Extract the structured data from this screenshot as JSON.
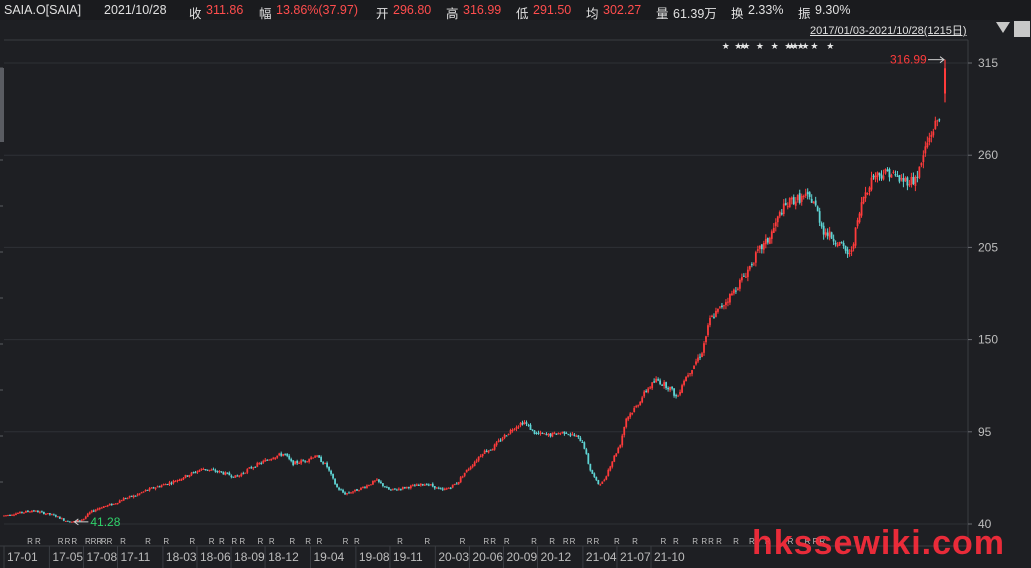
{
  "header": {
    "symbol": "SAIA.O[SAIA]",
    "date": "2021/10/28",
    "close_label": "收",
    "close_value": "311.86",
    "change_label": "幅",
    "change_value": "13.86%(37.97)",
    "open_label": "开",
    "open_value": "296.80",
    "high_label": "高",
    "high_value": "316.99",
    "low_label": "低",
    "low_value": "291.50",
    "avg_label": "均",
    "avg_value": "302.27",
    "volume_label": "量",
    "volume_value": "61.39万",
    "turnover_label": "换",
    "turnover_value": "2.33%",
    "amplitude_label": "振",
    "amplitude_value": "9.30%"
  },
  "range_label": "2017/01/03-2021/10/28(1215日)",
  "watermark": "hkssewiki.com",
  "colors": {
    "up": "#ff3b3b",
    "down": "#5fd4d4",
    "axis_text": "#bdbdbd",
    "grid": "#2e3036",
    "max_label": "#ff3b3b",
    "min_label": "#2fd26a",
    "background": "#1e1f23"
  },
  "chart_data": {
    "type": "candlestick",
    "y_ticks": [
      40,
      95,
      150,
      205,
      260,
      315
    ],
    "ylim": [
      36,
      322
    ],
    "x_ticks": [
      "17-01",
      "17-05",
      "17-08",
      "17-11",
      "18-03",
      "18-06",
      "18-09",
      "18-12",
      "19-04",
      "19-08",
      "19-11",
      "20-03",
      "20-06",
      "20-09",
      "20-12",
      "21-04",
      "21-07",
      "21-10"
    ],
    "max_marker": {
      "value": 316.99,
      "label": "316.99"
    },
    "min_marker": {
      "value": 41.28,
      "label": "41.28"
    },
    "series_path": [
      [
        0,
        45
      ],
      [
        2.5,
        48
      ],
      [
        4.5,
        45
      ],
      [
        5.4,
        42
      ],
      [
        6.2,
        41.3
      ],
      [
        7.0,
        43
      ],
      [
        7.6,
        47
      ],
      [
        8.5,
        50
      ],
      [
        9.7,
        52
      ],
      [
        10.5,
        55
      ],
      [
        11.6,
        57
      ],
      [
        12.5,
        60
      ],
      [
        13.4,
        62
      ],
      [
        14.8,
        65
      ],
      [
        16.5,
        70
      ],
      [
        17.5,
        73
      ],
      [
        19,
        71
      ],
      [
        20.5,
        68
      ],
      [
        21.6,
        73
      ],
      [
        22.5,
        76
      ],
      [
        23.7,
        80
      ],
      [
        24.7,
        82
      ],
      [
        25.4,
        76
      ],
      [
        26.6,
        78
      ],
      [
        27.4,
        81
      ],
      [
        28.4,
        75
      ],
      [
        29.3,
        62
      ],
      [
        30,
        58
      ],
      [
        31,
        60
      ],
      [
        32,
        63
      ],
      [
        32.8,
        66
      ],
      [
        34,
        60
      ],
      [
        35.5,
        62
      ],
      [
        37.3,
        64
      ],
      [
        38.6,
        60
      ],
      [
        39.3,
        62
      ],
      [
        40,
        65
      ],
      [
        40.5,
        70
      ],
      [
        41.2,
        75
      ],
      [
        42.2,
        83
      ],
      [
        43,
        85
      ],
      [
        44,
        92
      ],
      [
        45,
        98
      ],
      [
        45.8,
        101
      ],
      [
        46.8,
        94
      ],
      [
        48,
        93
      ],
      [
        49.5,
        95
      ],
      [
        50.4,
        92
      ],
      [
        51,
        89
      ],
      [
        51.6,
        73
      ],
      [
        52.3,
        64
      ],
      [
        52.8,
        65
      ],
      [
        53.4,
        75
      ],
      [
        54.3,
        88
      ],
      [
        54.8,
        103
      ],
      [
        55.7,
        110
      ],
      [
        56.6,
        120
      ],
      [
        57.5,
        126
      ],
      [
        58.7,
        121
      ],
      [
        59.3,
        115
      ],
      [
        59.8,
        125
      ],
      [
        60.6,
        133
      ],
      [
        61.5,
        143
      ],
      [
        62.2,
        162
      ],
      [
        63,
        168
      ],
      [
        64.2,
        178
      ],
      [
        65.4,
        190
      ],
      [
        66.5,
        203
      ],
      [
        67.4,
        210
      ],
      [
        68.5,
        227
      ],
      [
        69.4,
        233
      ],
      [
        70.6,
        235
      ],
      [
        71.3,
        233
      ],
      [
        72.2,
        215
      ],
      [
        73.5,
        208
      ],
      [
        74.5,
        200
      ],
      [
        74.8,
        208
      ],
      [
        75.7,
        235
      ],
      [
        76.6,
        248
      ],
      [
        78,
        250
      ],
      [
        79,
        245
      ],
      [
        80.2,
        245
      ],
      [
        80.7,
        252
      ],
      [
        81.2,
        265
      ],
      [
        82,
        278
      ],
      [
        82.4,
        282
      ]
    ],
    "last_candle": {
      "open": 296.8,
      "high": 316.99,
      "low": 291.5,
      "close": 311.86
    },
    "event_markers": {
      "stars_positions_months": [
        63.5,
        64.6,
        65.0,
        65.3,
        66.5,
        67.8,
        69.0,
        69.3,
        69.6,
        70.1,
        70.5,
        71.3,
        72.7
      ],
      "bottom_R_months": [
        2.3,
        3.0,
        5.0,
        5.6,
        6.2,
        7.4,
        7.9,
        8.4,
        8.8,
        9.3,
        10.5,
        12.7,
        14.3,
        16.6,
        18.3,
        19.2,
        20.3,
        21.0,
        22.6,
        23.6,
        25.4,
        26.8,
        27.8,
        30.1,
        31.1,
        34.9,
        37.3,
        40.4,
        42.5,
        43.1,
        44.3,
        46.7,
        48.3,
        49.5,
        50.1,
        51.6,
        52.2,
        54.0,
        55.6,
        58.1,
        59.2,
        60.9,
        61.7,
        62.3,
        63.0,
        64.5,
        65.9,
        67.3,
        69.3,
        70.8,
        71.5,
        72.1
      ]
    }
  }
}
